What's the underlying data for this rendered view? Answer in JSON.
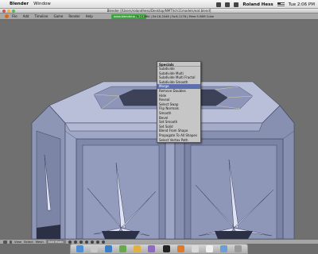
{
  "mac_menubar": {
    "app_name": "Blender",
    "menus": [
      "Window"
    ],
    "user": "Roland Hess",
    "clock": "Tue 2:06 PM"
  },
  "window": {
    "title": "Blender [/Users/rolandhess/Desktop/NMTI/ch11models/eat.blend]"
  },
  "blender_header": {
    "menus": [
      "File",
      "Add",
      "Timeline",
      "Game",
      "Render",
      "Help"
    ],
    "info_tag": "www.blender.org 242",
    "stats": "Ve:24-984 | Ed:16-2048 | Fa:8-1178 | Mem:5.98M Cube"
  },
  "specials_menu": {
    "title": "Specials",
    "items": [
      "Subdivide",
      "Subdivide Multi",
      "Subdivide Multi Fractal",
      "Subdivide Smooth",
      "Merge",
      "Remove Doubles",
      "Hide",
      "Reveal",
      "Select Swap",
      "Flip Normals",
      "Smooth",
      "Bevel",
      "Set Smooth",
      "Set Solid",
      "Blend From Shape",
      "Propagate To All Shapes",
      "Select Vertex Path"
    ],
    "active_index": 4
  },
  "bottom_header": {
    "menus": [
      "View",
      "Select",
      "Mesh"
    ],
    "mode": "Edit Mode"
  },
  "colors": {
    "viewport_bg": "#707070",
    "mesh_face": "#9aa3c4",
    "mesh_dark": "#5c6486",
    "menu_highlight": "#5d6fae",
    "info_green": "#3ea33e"
  },
  "dock_icons": [
    "finder-icon",
    "mail-icon",
    "safari-icon",
    "itunes-icon",
    "ichat-icon",
    "photo-icon",
    "terminal-icon",
    "blender-icon",
    "preview-icon",
    "textedit-icon",
    "folder-icon",
    "trash-icon"
  ]
}
